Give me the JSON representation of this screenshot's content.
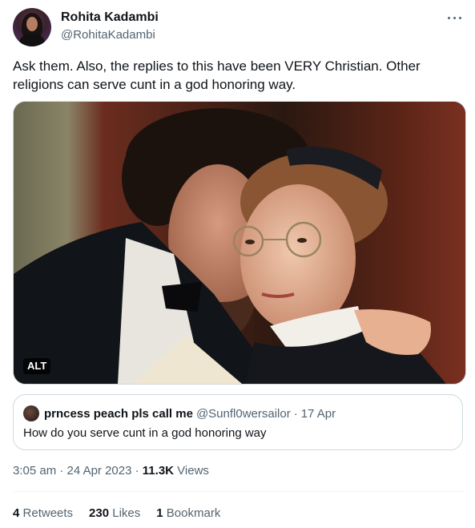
{
  "author": {
    "display_name": "Rohita Kadambi",
    "handle": "@RohitaKadambi",
    "avatar_icon": "profile-photo"
  },
  "menu_icon": "more-horizontal-icon",
  "tweet": {
    "text": "Ask them. Also, the replies to this have been VERY Christian. Other religions can serve cunt in a god honoring way."
  },
  "media": {
    "alt_badge": "ALT"
  },
  "quote": {
    "display_name": "prncess peach pls call me",
    "handle": "@Sunfl0wersailor",
    "separator": "·",
    "date": "17 Apr",
    "text": "How do you serve cunt in a god honoring way"
  },
  "meta": {
    "time": "3:05 am",
    "separator": "·",
    "date": "24 Apr 2023",
    "views_count": "11.3K",
    "views_label": "Views"
  },
  "stats": {
    "retweets_count": "4",
    "retweets_label": "Retweets",
    "likes_count": "230",
    "likes_label": "Likes",
    "bookmarks_count": "1",
    "bookmarks_label": "Bookmark"
  },
  "colors": {
    "text_primary": "#0f1419",
    "text_secondary": "#536471",
    "border": "#cfd9de"
  }
}
